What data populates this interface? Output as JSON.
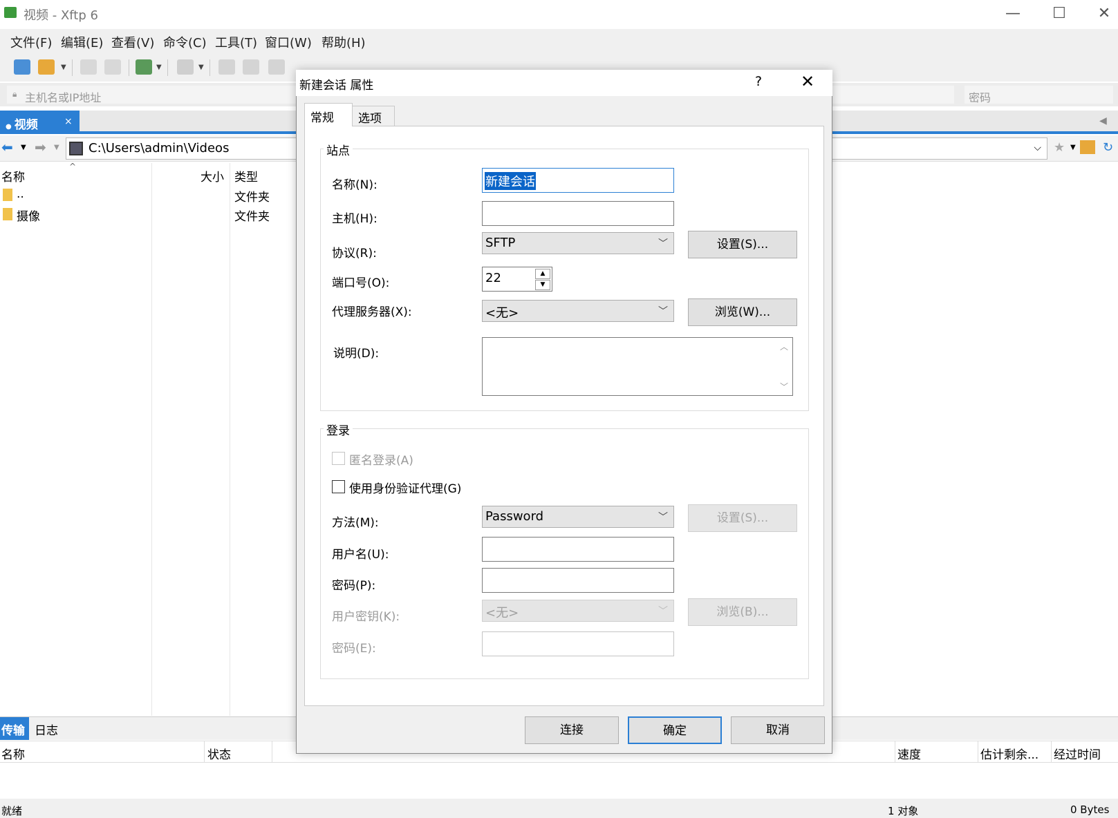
{
  "window": {
    "title": "视频 - Xftp 6",
    "minimize": "—",
    "maximize": "☐",
    "close": "✕"
  },
  "menu": [
    "文件(F)",
    "编辑(E)",
    "查看(V)",
    "命令(C)",
    "工具(T)",
    "窗口(W)",
    "帮助(H)"
  ],
  "address": {
    "host_placeholder": "主机名或IP地址",
    "password_placeholder": "密码"
  },
  "tab": {
    "label": "视频",
    "close": "×"
  },
  "path": {
    "value": "C:\\Users\\admin\\Videos"
  },
  "filelist": {
    "columns": {
      "name": "名称",
      "size": "大小",
      "type": "类型"
    },
    "rows": [
      {
        "name": "..",
        "type": "文件夹"
      },
      {
        "name": "摄像",
        "type": "文件夹"
      }
    ]
  },
  "bottom": {
    "tabs": {
      "transfer": "传输",
      "log": "日志"
    },
    "columns": {
      "name": "名称",
      "status": "状态",
      "speed": "速度",
      "remaining": "估计剩余...",
      "elapsed": "经过时间"
    }
  },
  "status": {
    "left": "就绪",
    "objects": "1 对象",
    "bytes": "0 Bytes"
  },
  "dialog": {
    "title": "新建会话 属性",
    "help": "?",
    "close": "✕",
    "tabs": {
      "general": "常规",
      "options": "选项"
    },
    "site": {
      "group": "站点",
      "name_label": "名称(N):",
      "name_value": "新建会话",
      "host_label": "主机(H):",
      "protocol_label": "协议(R):",
      "protocol_value": "SFTP",
      "protocol_settings": "设置(S)...",
      "port_label": "端口号(O):",
      "port_value": "22",
      "proxy_label": "代理服务器(X):",
      "proxy_value": "<无>",
      "proxy_browse": "浏览(W)...",
      "desc_label": "说明(D):"
    },
    "login": {
      "group": "登录",
      "anonymous": "匿名登录(A)",
      "agent": "使用身份验证代理(G)",
      "method_label": "方法(M):",
      "method_value": "Password",
      "method_settings": "设置(S)...",
      "user_label": "用户名(U):",
      "password_label": "密码(P):",
      "userkey_label": "用户密钥(K):",
      "userkey_value": "<无>",
      "userkey_browse": "浏览(B)...",
      "passphrase_label": "密码(E):"
    },
    "buttons": {
      "connect": "连接",
      "ok": "确定",
      "cancel": "取消"
    }
  }
}
